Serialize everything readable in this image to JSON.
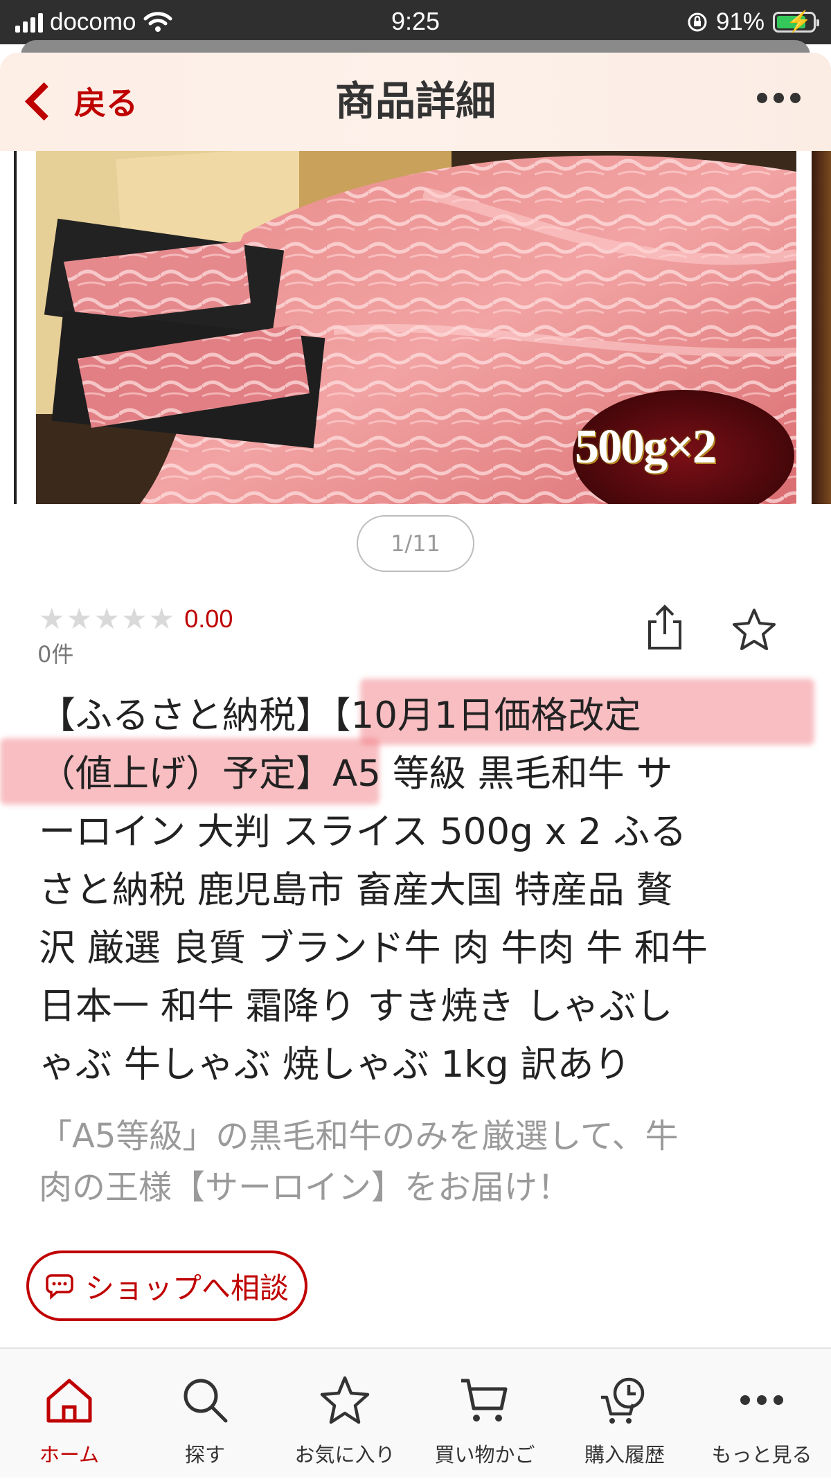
{
  "status_bar": {
    "carrier": "docomo",
    "time": "9:25",
    "battery": "91%"
  },
  "header": {
    "back_label": "戻る",
    "title": "商品詳細",
    "more_icon": "more-horizontal-icon"
  },
  "gallery": {
    "image_badge": "500g×2",
    "page_indicator": "1/11"
  },
  "rating": {
    "stars": 0,
    "value": "0.00",
    "review_count": "0件"
  },
  "product": {
    "title_lines": [
      "【ふるさと納税】【10月1日価格改定",
      "（値上げ）予定】A5 等級 黒毛和牛 サ",
      "ーロイン 大判 スライス 500g x 2 ふる",
      "さと納税 鹿児島市 畜産大国 特産品 贅",
      "沢 厳選 良質 ブランド牛 肉 牛肉 牛 和牛",
      "日本一 和牛 霜降り すき焼き しゃぶし",
      "ゃぶ 牛しゃぶ 焼しゃぶ 1kg 訳あり"
    ],
    "catch_copy_lines": [
      "「A5等級」の黒毛和牛のみを厳選して、牛",
      "肉の王様【サーロイン】をお届け！"
    ]
  },
  "actions": {
    "consult_label": "ショップへ相談"
  },
  "bottom_nav": {
    "items": [
      {
        "label": "ホーム",
        "icon": "home-icon",
        "active": true
      },
      {
        "label": "探す",
        "icon": "search-icon",
        "active": false
      },
      {
        "label": "お気に入り",
        "icon": "star-icon",
        "active": false
      },
      {
        "label": "買い物かご",
        "icon": "cart-icon",
        "active": false
      },
      {
        "label": "購入履歴",
        "icon": "history-cart-icon",
        "active": false
      },
      {
        "label": "もっと見る",
        "icon": "more-horizontal-icon",
        "active": false
      }
    ]
  },
  "colors": {
    "accent": "#bf0000",
    "highlight": "#f06e78"
  }
}
